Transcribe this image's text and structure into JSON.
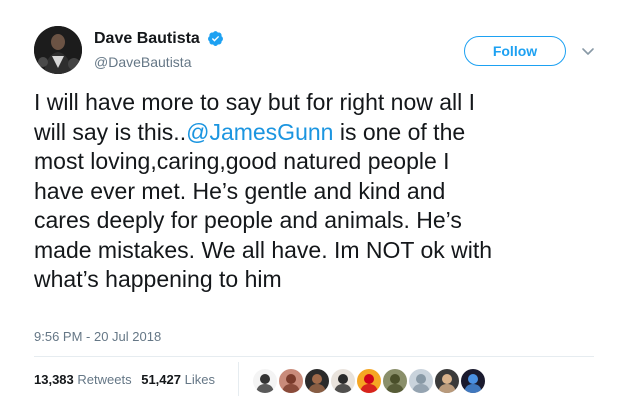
{
  "tweet": {
    "author": {
      "display_name": "Dave Bautista",
      "handle": "@DaveBautista",
      "verified": true,
      "avatar_icon": "profile-photo"
    },
    "follow_label": "Follow",
    "text_before": "I will have more to say but for right now all I\nwill say is this..",
    "mention": "@JamesGunn",
    "text_after": " is one of the\nmost loving,caring,good natured people I\nhave ever met. He’s gentle and kind and\ncares deeply for people and animals. He’s\nmade mistakes. We all have. Im NOT ok with\nwhat’s happening to him",
    "timestamp": "9:56 PM - 20 Jul 2018",
    "stats": {
      "retweets_count": "13,383",
      "retweets_label": "Retweets",
      "likes_count": "51,427",
      "likes_label": "Likes"
    },
    "likers": [
      {
        "name": "liker-avatar-1",
        "bg": "#f4f4f4",
        "fg": "#333333"
      },
      {
        "name": "liker-avatar-2",
        "bg": "#c98b7a",
        "fg": "#7a3b2b"
      },
      {
        "name": "liker-avatar-3",
        "bg": "#2b2b2b",
        "fg": "#a06a4a"
      },
      {
        "name": "liker-avatar-4",
        "bg": "#e9e3dc",
        "fg": "#2a2a2a"
      },
      {
        "name": "liker-avatar-5",
        "bg": "#f5a623",
        "fg": "#d0021b"
      },
      {
        "name": "liker-avatar-6",
        "bg": "#8a8f6a",
        "fg": "#4a4f2a"
      },
      {
        "name": "liker-avatar-7",
        "bg": "#c9d3dc",
        "fg": "#8899a6"
      },
      {
        "name": "liker-avatar-8",
        "bg": "#3a3a3a",
        "fg": "#d9b38c"
      },
      {
        "name": "liker-avatar-9",
        "bg": "#1a1a2e",
        "fg": "#4a90e2"
      }
    ]
  },
  "colors": {
    "accent": "#1da1f2",
    "mention": "#1b95e0",
    "text": "#14171a",
    "secondary": "#657786",
    "divider": "#e6ecf0"
  }
}
